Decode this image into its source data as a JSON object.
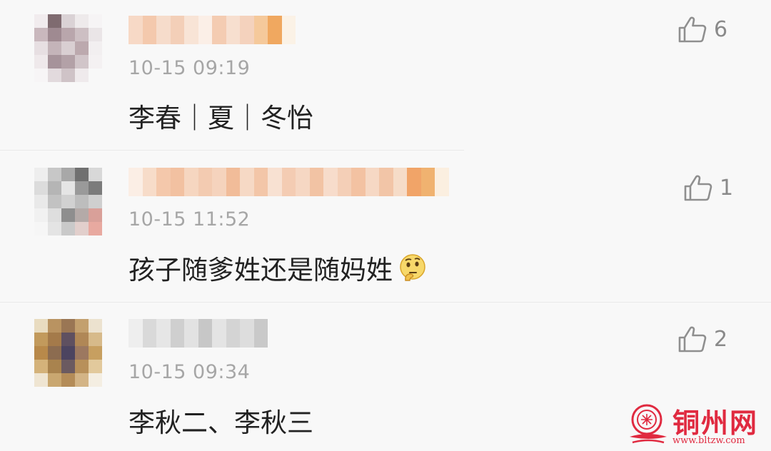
{
  "comments": [
    {
      "time": "10-15 09:19",
      "text": "李春｜夏｜冬怡",
      "likes": "6",
      "icons": {
        "like": "thumbs-up-icon"
      }
    },
    {
      "time": "10-15 11:52",
      "text": "孩子随爹姓还是随妈姓",
      "likes": "1",
      "icons": {
        "like": "thumbs-up-icon",
        "emoji": "thinking-face-emoji-icon"
      }
    },
    {
      "time": "10-15 09:34",
      "text": "李秋二、李秋三",
      "likes": "2",
      "icons": {
        "like": "thumbs-up-icon"
      }
    }
  ],
  "watermark": {
    "title": "铜州网",
    "url": "www.bltzw.com",
    "icon": "tongzhou-logo-icon",
    "color": "#e02a40"
  }
}
